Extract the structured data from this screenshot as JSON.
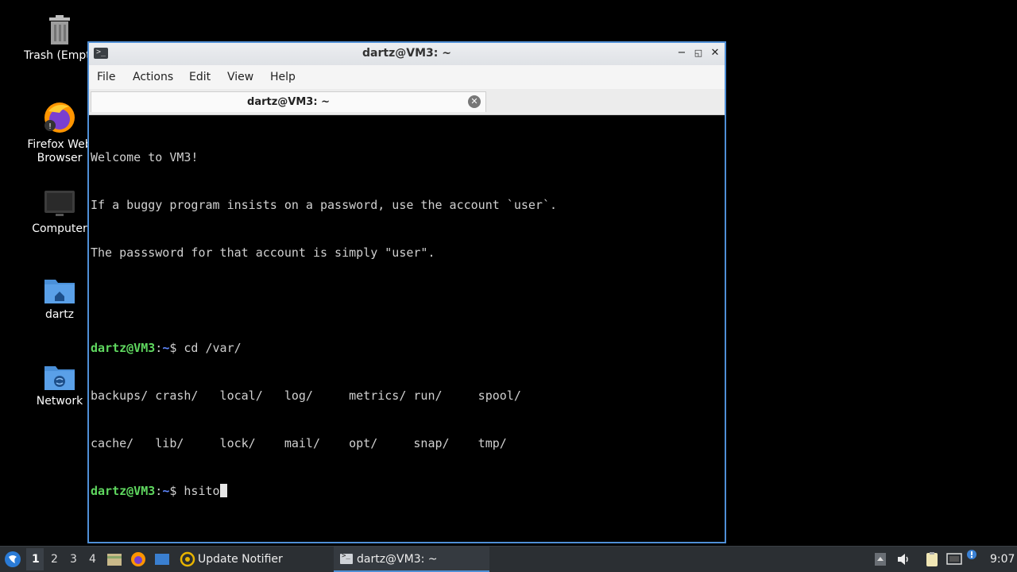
{
  "desktop": {
    "icons": [
      {
        "label": "Trash (Empty)"
      },
      {
        "label": "Firefox Web Browser"
      },
      {
        "label": "Computer"
      },
      {
        "label": "dartz"
      },
      {
        "label": "Network"
      }
    ]
  },
  "window": {
    "title": "dartz@VM3: ~",
    "menu": [
      "File",
      "Actions",
      "Edit",
      "View",
      "Help"
    ],
    "tab_title": "dartz@VM3: ~"
  },
  "terminal": {
    "welcome": [
      "Welcome to VM3!",
      "If a buggy program insists on a password, use the account `user`.",
      "The passsword for that account is simply \"user\"."
    ],
    "prompt_user": "dartz@VM3",
    "prompt_path": "~",
    "prompt_sep": ":",
    "prompt_end": "$ ",
    "command1": "cd /var/",
    "listing": [
      "backups/ crash/   local/   log/     metrics/ run/     spool/",
      "cache/   lib/     lock/    mail/    opt/     snap/    tmp/"
    ],
    "current_input": "hsito"
  },
  "taskbar": {
    "workspaces": [
      "1",
      "2",
      "3",
      "4"
    ],
    "active_workspace": "1",
    "tasks": [
      {
        "label": "Update Notifier"
      },
      {
        "label": "dartz@VM3: ~"
      }
    ],
    "clock": "9:07"
  },
  "colors": {
    "prompt_user": "#5fd75f",
    "prompt_path": "#5f87ff",
    "window_border": "#4f8fd6",
    "taskbar_bg": "#2b2f33"
  }
}
